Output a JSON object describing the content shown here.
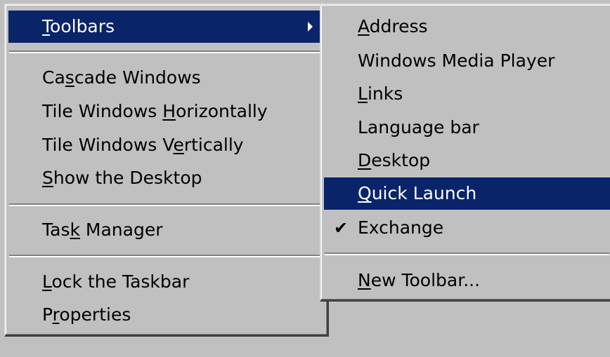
{
  "main_menu": {
    "items": [
      {
        "pre": "",
        "acc": "T",
        "post": "oolbars",
        "has_submenu": true,
        "highlighted": true
      },
      {
        "pre": "Ca",
        "acc": "s",
        "post": "cade Windows"
      },
      {
        "pre": "Tile Windows ",
        "acc": "H",
        "post": "orizontally"
      },
      {
        "pre": "Tile Windows V",
        "acc": "e",
        "post": "rtically"
      },
      {
        "pre": "",
        "acc": "S",
        "post": "how the Desktop"
      },
      {
        "pre": "Tas",
        "acc": "k",
        "post": " Manager"
      },
      {
        "pre": "",
        "acc": "L",
        "post": "ock the Taskbar"
      },
      {
        "pre": "P",
        "acc": "r",
        "post": "operties"
      }
    ]
  },
  "sub_menu": {
    "items": [
      {
        "pre": "",
        "acc": "A",
        "post": "ddress"
      },
      {
        "pre": "Windows Media Player",
        "acc": "",
        "post": ""
      },
      {
        "pre": "",
        "acc": "L",
        "post": "inks"
      },
      {
        "pre": "Language bar",
        "acc": "",
        "post": ""
      },
      {
        "pre": "",
        "acc": "D",
        "post": "esktop"
      },
      {
        "pre": "",
        "acc": "Q",
        "post": "uick Launch",
        "highlighted": true
      },
      {
        "pre": "Exchange",
        "acc": "",
        "post": "",
        "checked": true
      },
      {
        "pre": "",
        "acc": "N",
        "post": "ew Toolbar..."
      }
    ]
  },
  "colors": {
    "menu_bg": "#c0c0c0",
    "highlight": "#0a246a",
    "highlight_text": "#ffffff"
  },
  "icons": {
    "submenu_arrow": "triangle-right",
    "check": "check-mark"
  }
}
